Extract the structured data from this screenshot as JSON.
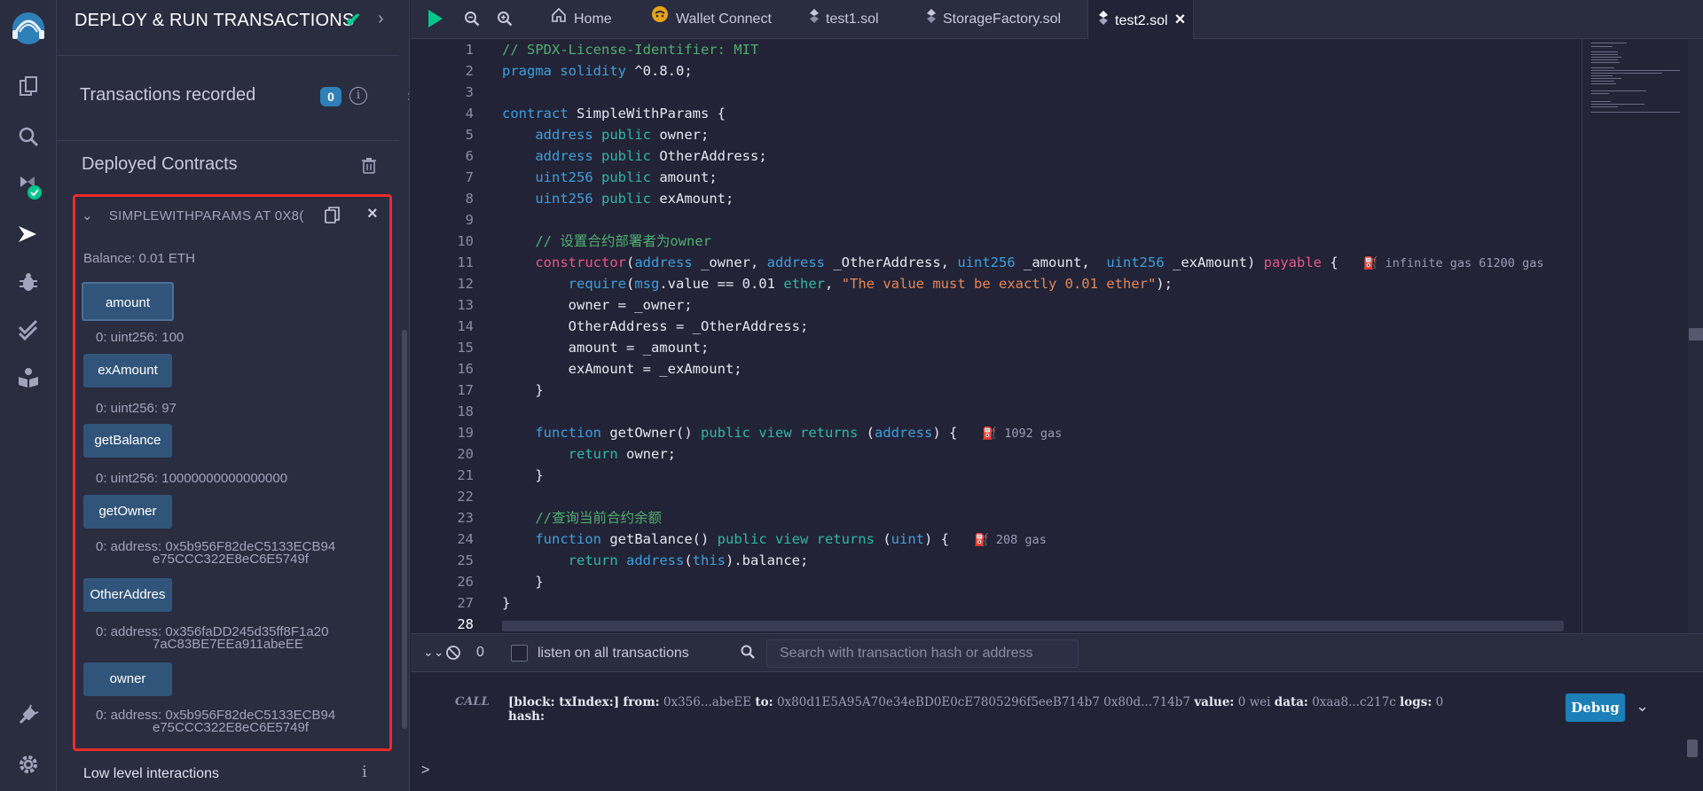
{
  "panel": {
    "title": "DEPLOY & RUN TRANSACTIONS",
    "transactions_label": "Transactions recorded",
    "transactions_count": "0",
    "deployed_label": "Deployed Contracts",
    "contract_name": "SIMPLEWITHPARAMS AT 0X8(",
    "balance": "Balance: 0.01 ETH",
    "functions": [
      {
        "label": "amount",
        "output": "0: uint256: 100"
      },
      {
        "label": "exAmount",
        "output": "0: uint256: 97"
      },
      {
        "label": "getBalance",
        "output": "0: uint256: 10000000000000000"
      },
      {
        "label": "getOwner",
        "output_1": "0:  address: 0x5b956F82deC5133ECB94",
        "output_2": "e75CCC322E8eC6E5749f"
      },
      {
        "label": "OtherAddres",
        "output_1": "0:  address: 0x356faDD245d35ff8F1a20",
        "output_2": "7aC83BE7EEa911abeEE"
      },
      {
        "label": "owner",
        "output_1": "0:  address: 0x5b956F82deC5133ECB94",
        "output_2": "e75CCC322E8eC6E5749f"
      }
    ],
    "low_level": "Low level interactions"
  },
  "tabs": [
    {
      "label": "Home",
      "icon": "home-icon"
    },
    {
      "label": "Wallet Connect",
      "icon": "wallet-connect-icon"
    },
    {
      "label": "test1.sol",
      "icon": "solidity-icon"
    },
    {
      "label": "StorageFactory.sol",
      "icon": "solidity-icon"
    },
    {
      "label": "test2.sol",
      "icon": "solidity-icon"
    }
  ],
  "editor": {
    "current_line": 28,
    "gas": {
      "constructor": "infinite gas 61200 gas",
      "getOwner": "1092 gas",
      "getBalance": "208 gas"
    }
  },
  "terminal": {
    "count": "0",
    "listen_label": "listen on all transactions",
    "search_placeholder": "Search with transaction hash or address",
    "call_label": "CALL",
    "log": {
      "block": "[block: txIndex:]",
      "from_label": "from:",
      "from": "0x356...abeEE",
      "to_label": "to:",
      "to": "0x80d1E5A95A70e34eBD0E0cE7805296f5eeB714b7 0x80d...714b7",
      "value_label": "value:",
      "value": "0 wei",
      "data_label": "data:",
      "data": "0xaa8...c217c",
      "logs_label": "logs:",
      "logs": "0",
      "hash_label": "hash:"
    },
    "debug_label": "Debug",
    "prompt": ">"
  },
  "colors": {
    "accent": "#1c7fb8",
    "highlight_border": "#ee2a2a",
    "success": "#00c88a",
    "background": "#222336",
    "panel": "#2a2c3f"
  }
}
